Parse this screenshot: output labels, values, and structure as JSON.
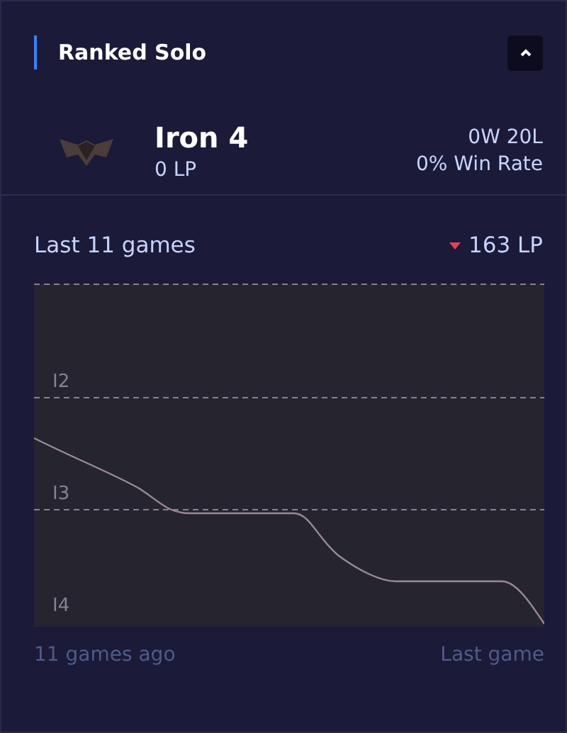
{
  "header": {
    "title": "Ranked Solo",
    "expanded": true
  },
  "rank": {
    "tier": "Iron 4",
    "lp": "0 LP",
    "record": "0W 20L",
    "win_rate": "0% Win Rate"
  },
  "history": {
    "title": "Last 11 games",
    "falling": true,
    "change": "163 LP",
    "tiers": [
      "I2",
      "I3",
      "I4"
    ],
    "start_label": "11 games ago",
    "end_label": "Last game"
  }
}
